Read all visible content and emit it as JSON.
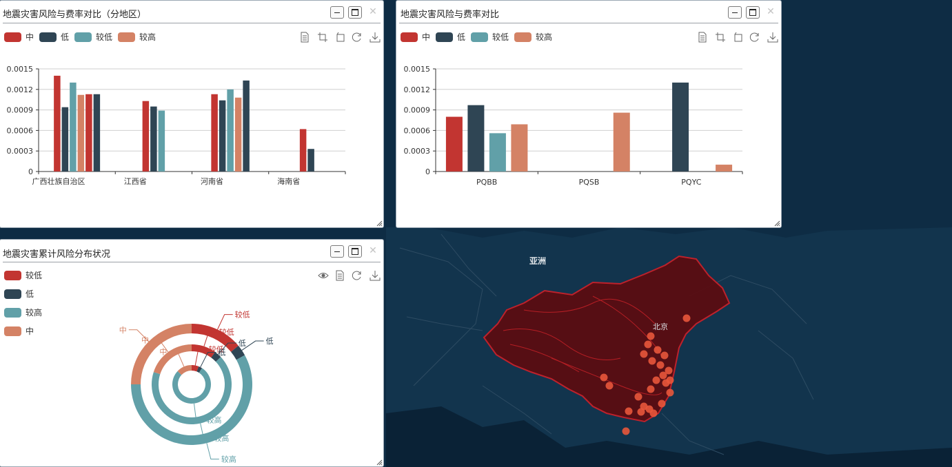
{
  "colors": {
    "zhong": "#c23531",
    "di": "#2f4554",
    "jiaodi": "#61a0a8",
    "jiaogao": "#d48265"
  },
  "map": {
    "continent_label": "亚洲",
    "city_label": "北京"
  },
  "panel1": {
    "title": "地震灾害风险与费率对比（分地区）",
    "legend": [
      "中",
      "低",
      "较低",
      "较高"
    ],
    "chart_data": {
      "type": "bar",
      "categories": [
        "广西壮族自治区",
        "江西省",
        "河南省",
        "海南省"
      ],
      "yticks": [
        "0",
        "0.0003",
        "0.0006",
        "0.0009",
        "0.0012",
        "0.0015"
      ],
      "ylim": [
        0,
        0.0015
      ],
      "series": [
        {
          "name": "中",
          "values": [
            [
              0.0014,
              0.00113
            ],
            [
              0.00103
            ],
            [
              0.00113
            ],
            [
              0.00062
            ]
          ]
        },
        {
          "name": "低",
          "values": [
            [
              0.00094,
              0.00113
            ],
            [
              0.00095
            ],
            [
              0.00104,
              0.00133
            ],
            [
              0.00033
            ]
          ]
        },
        {
          "name": "较低",
          "values": [
            [
              0.0013
            ],
            [
              0.00089
            ],
            [
              0.0012
            ],
            []
          ]
        },
        {
          "name": "较高",
          "values": [
            [
              0.00112
            ],
            [],
            [
              0.00108
            ],
            []
          ]
        }
      ]
    }
  },
  "panel2": {
    "title": "地震灾害风险与费率对比",
    "legend": [
      "中",
      "低",
      "较低",
      "较高"
    ],
    "chart_data": {
      "type": "bar",
      "categories": [
        "PQBB",
        "PQSB",
        "PQYC"
      ],
      "yticks": [
        "0",
        "0.0003",
        "0.0006",
        "0.0009",
        "0.0012",
        "0.0015"
      ],
      "ylim": [
        0,
        0.0015
      ],
      "series": [
        {
          "name": "中",
          "values": [
            0.0008,
            0,
            0
          ]
        },
        {
          "name": "低",
          "values": [
            0.00097,
            0,
            0.0013
          ]
        },
        {
          "name": "较低",
          "values": [
            0.00056,
            0,
            0
          ]
        },
        {
          "name": "较高",
          "values": [
            0.00069,
            0.00086,
            0.0001
          ]
        }
      ]
    }
  },
  "panel3": {
    "title": "地震灾害累计风险分布状况",
    "legend": [
      "较低",
      "低",
      "较高",
      "中"
    ],
    "chart_data": {
      "type": "pie",
      "rings": [
        {
          "name": "outer",
          "slices": [
            {
              "label": "较低",
              "value": 14
            },
            {
              "label": "低",
              "value": 3
            },
            {
              "label": "较高",
              "value": 58
            },
            {
              "label": "中",
              "value": 25
            }
          ]
        },
        {
          "name": "middle",
          "slices": [
            {
              "label": "较低",
              "value": 10
            },
            {
              "label": "低",
              "value": 3
            },
            {
              "label": "较高",
              "value": 67
            },
            {
              "label": "中",
              "value": 20
            }
          ]
        },
        {
          "name": "inner",
          "slices": [
            {
              "label": "较低",
              "value": 6
            },
            {
              "label": "低",
              "value": 3
            },
            {
              "label": "较高",
              "value": 78
            },
            {
              "label": "中",
              "value": 13
            }
          ]
        }
      ]
    }
  }
}
